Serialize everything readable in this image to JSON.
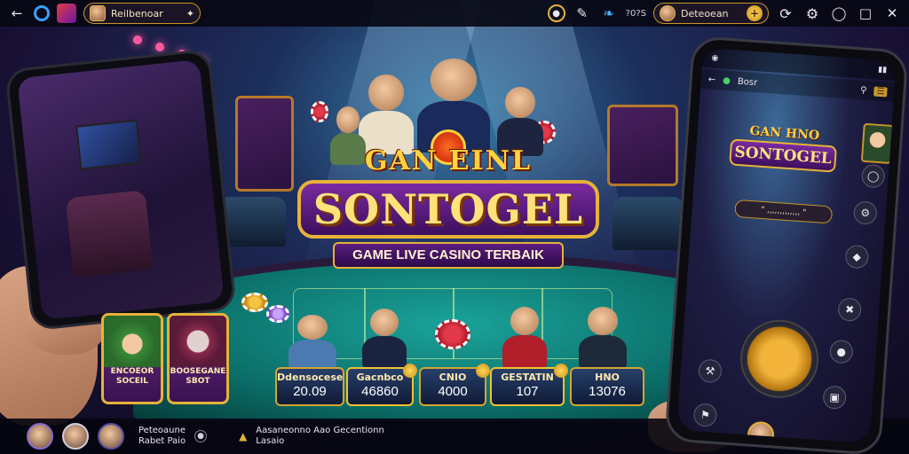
{
  "topbar": {
    "back_icon": "back-arrow-icon",
    "search_label": "Reilbenoar",
    "balance_label": "Deteoean",
    "status_text": "?0?S"
  },
  "logo": {
    "top_text": "GAN  EINL",
    "main_text": "SONTOGEL",
    "subtitle": "GAME LIVE CASINO TERBAIK"
  },
  "feature_cards": [
    {
      "line1": "ENCOEOR",
      "line2": "SOCEIL"
    },
    {
      "line1": "BOOSEGANE",
      "line2": "SBOT"
    }
  ],
  "players": [
    {
      "name": "Ddensocese",
      "value": "20.09"
    },
    {
      "name": "Gacnbco",
      "value": "46860"
    },
    {
      "name": "CNIO",
      "value": "4000"
    },
    {
      "name": "GESTATIN",
      "value": "107"
    },
    {
      "name": "HNO",
      "value": "13076"
    }
  ],
  "phone_right": {
    "nav_title": "Bosr",
    "logo_top": "GAN  HNO",
    "logo_main": "SONTOGEL",
    "bar_text": "\" ,,,,,,,,,,,,, \""
  },
  "bottombar": {
    "user_line1": "Peteoaune",
    "user_line2": "Rabet Paio",
    "message_line1": "Aasaneonno  Aao  Gecentionn",
    "message_line2": "Lasaio"
  },
  "colors": {
    "gold": "#e6b23a",
    "purple": "#5a1d80",
    "felt": "#0b6e68"
  }
}
